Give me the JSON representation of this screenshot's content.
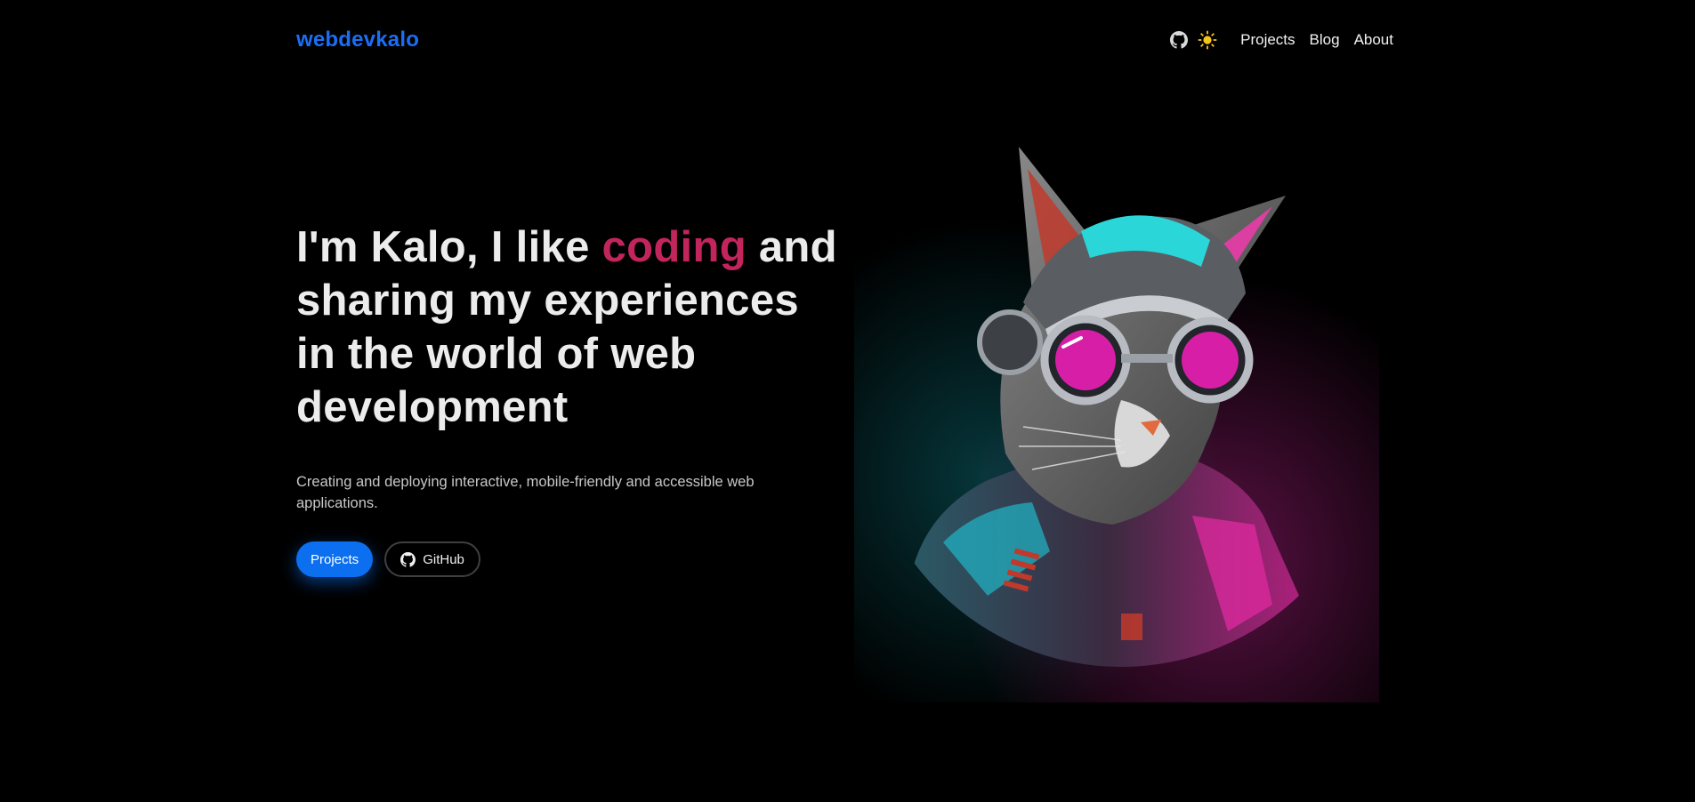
{
  "header": {
    "brand": "webdevkalo",
    "icons": [
      "github-icon",
      "sun-icon"
    ],
    "nav": [
      {
        "label": "Projects"
      },
      {
        "label": "Blog"
      },
      {
        "label": "About"
      }
    ]
  },
  "hero": {
    "title_before": "I'm Kalo, I like ",
    "title_accent": "coding",
    "title_after": " and sharing my experiences in the world of web development",
    "subtitle": "Creating and deploying interactive, mobile-friendly and accessible web applications.",
    "primary_button": "Projects",
    "secondary_button": "GitHub",
    "secondary_icon": "github-icon",
    "illustration": "cyberpunk-cat-illustration"
  },
  "colors": {
    "background": "#000000",
    "brand": "#1b6ef3",
    "accent": "#c2255c",
    "primary_button": "#0b6ff0",
    "sun": "#f5c518"
  }
}
